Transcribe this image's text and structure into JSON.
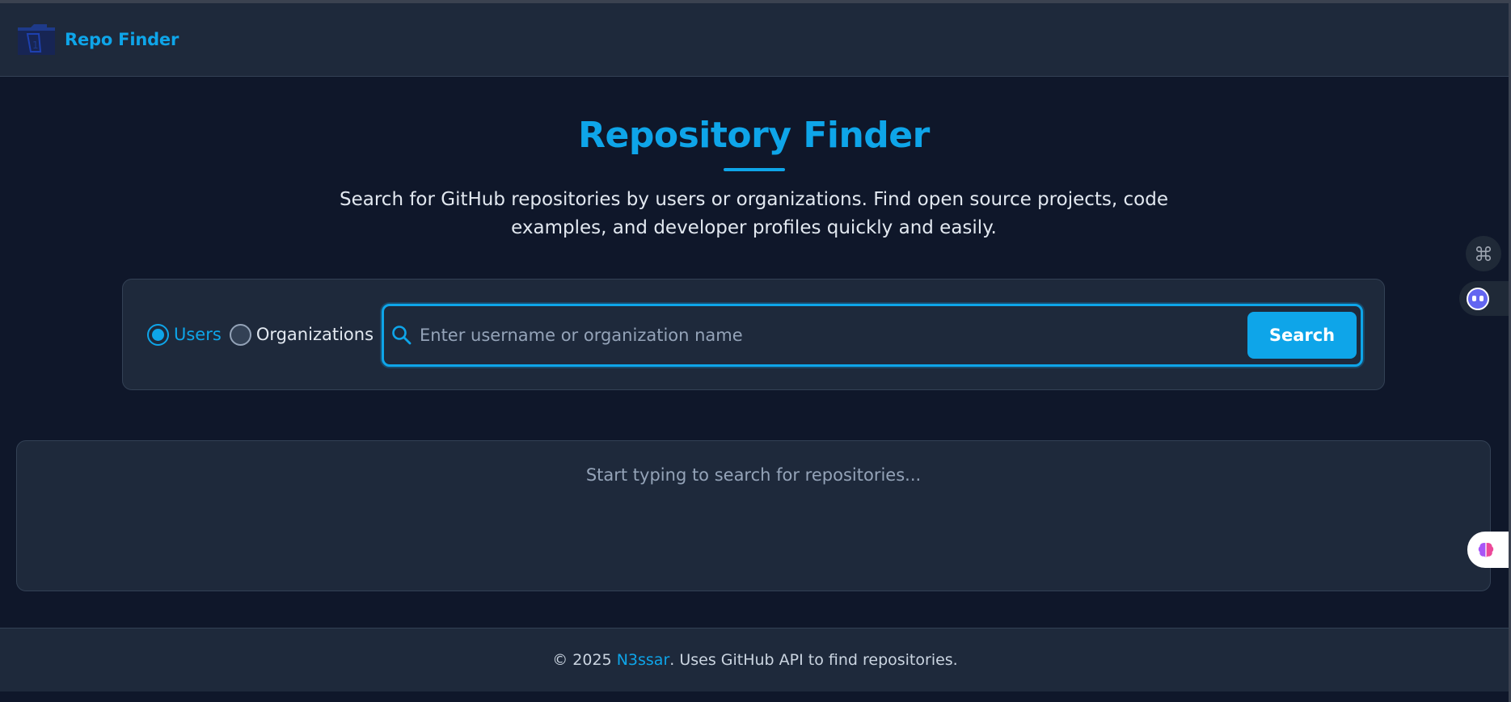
{
  "header": {
    "brand": "Repo Finder",
    "logo_icon": "repository-folder-icon"
  },
  "hero": {
    "title": "Repository Finder",
    "description": "Search for GitHub repositories by users or organizations. Find open source projects, code examples, and developer profiles quickly and easily."
  },
  "search": {
    "options": [
      {
        "label": "Users",
        "checked": true
      },
      {
        "label": "Organizations",
        "checked": false
      }
    ],
    "input_value": "",
    "placeholder": "Enter username or organization name",
    "button_label": "Search",
    "icon": "search-icon"
  },
  "results": {
    "message": "Start typing to search for repositories..."
  },
  "footer": {
    "copyright": "© 2025",
    "author": "N3ssar",
    "tail": ". Uses GitHub API to find repositories."
  },
  "extensions": {
    "icons": [
      "command-icon",
      "bot-icon",
      "brain-icon"
    ]
  },
  "colors": {
    "accent": "#0ea5e9",
    "background": "#0f172a",
    "surface": "#1e293b",
    "border": "#334155",
    "muted_text": "#94a3b8"
  }
}
